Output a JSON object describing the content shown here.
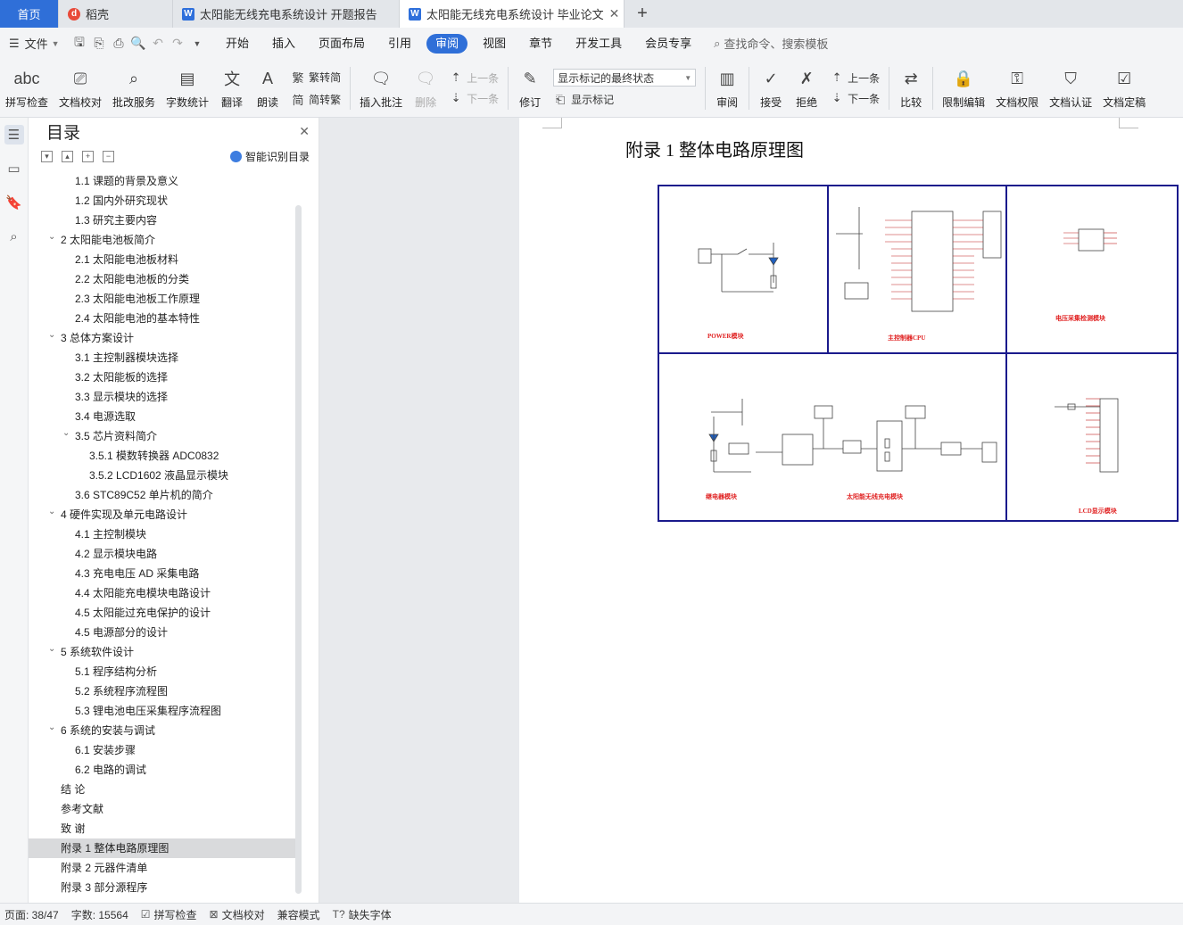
{
  "tabs": {
    "home": "首页",
    "app": "稻壳",
    "doc1": "太阳能无线充电系统设计 开题报告",
    "doc2": "太阳能无线充电系统设计 毕业论文",
    "add": "+"
  },
  "menu": {
    "file": "文件",
    "items": [
      "开始",
      "插入",
      "页面布局",
      "引用",
      "审阅",
      "视图",
      "章节",
      "开发工具",
      "会员专享"
    ],
    "active": "审阅",
    "search": "查找命令、搜索模板"
  },
  "ribbon": {
    "spell": "拼写检查",
    "doc_check": "文档校对",
    "correction": "批改服务",
    "word_count": "字数统计",
    "translate": "翻译",
    "read": "朗读",
    "trad_to_simp": "繁转简",
    "simp_to_trad": "简转繁",
    "insert_comment": "插入批注",
    "delete": "删除",
    "prev": "上一条",
    "next": "下一条",
    "track": "修订",
    "markup_state": "显示标记的最终状态",
    "show_markup": "显示标记",
    "review": "审阅",
    "accept": "接受",
    "reject": "拒绝",
    "prev2": "上一条",
    "next2": "下一条",
    "compare": "比较",
    "restrict": "限制编辑",
    "permission": "文档权限",
    "certify": "文档认证",
    "finalize": "文档定稿"
  },
  "toc": {
    "title": "目录",
    "smart": "智能识别目录",
    "items": [
      {
        "text": "1.1 课题的背景及意义",
        "level": 2
      },
      {
        "text": "1.2 国内外研究现状",
        "level": 2
      },
      {
        "text": "1.3 研究主要内容",
        "level": 2
      },
      {
        "text": "2  太阳能电池板简介",
        "level": 1
      },
      {
        "text": "2.1 太阳能电池板材料",
        "level": 2
      },
      {
        "text": "2.2 太阳能电池板的分类",
        "level": 2
      },
      {
        "text": "2.3 太阳能电池板工作原理",
        "level": 2
      },
      {
        "text": "2.4 太阳能电池的基本特性",
        "level": 2
      },
      {
        "text": "3  总体方案设计",
        "level": 1
      },
      {
        "text": "3.1 主控制器模块选择",
        "level": 2
      },
      {
        "text": "3.2 太阳能板的选择",
        "level": 2
      },
      {
        "text": "3.3 显示模块的选择",
        "level": 2
      },
      {
        "text": "3.4 电源选取",
        "level": 2
      },
      {
        "text": "3.5 芯片资料简介",
        "level": 2,
        "expand": true
      },
      {
        "text": "3.5.1 模数转换器 ADC0832",
        "level": 3
      },
      {
        "text": "3.5.2 LCD1602 液晶显示模块",
        "level": 3
      },
      {
        "text": "3.6 STC89C52 单片机的简介",
        "level": 2
      },
      {
        "text": "4  硬件实现及单元电路设计",
        "level": 1
      },
      {
        "text": "4.1 主控制模块",
        "level": 2
      },
      {
        "text": "4.2 显示模块电路",
        "level": 2
      },
      {
        "text": "4.3 充电电压 AD 采集电路",
        "level": 2
      },
      {
        "text": "4.4 太阳能充电模块电路设计",
        "level": 2
      },
      {
        "text": "4.5 太阳能过充电保护的设计",
        "level": 2
      },
      {
        "text": "4.5 电源部分的设计",
        "level": 2
      },
      {
        "text": "5  系统软件设计",
        "level": 1
      },
      {
        "text": "5.1 程序结构分析",
        "level": 2
      },
      {
        "text": "5.2 系统程序流程图",
        "level": 2
      },
      {
        "text": "5.3 锂电池电压采集程序流程图",
        "level": 2
      },
      {
        "text": "6  系统的安装与调试",
        "level": 1
      },
      {
        "text": "6.1 安装步骤",
        "level": 2
      },
      {
        "text": "6.2 电路的调试",
        "level": 2
      },
      {
        "text": "结   论",
        "level": 0
      },
      {
        "text": "参考文献",
        "level": 0
      },
      {
        "text": "致   谢",
        "level": 0
      },
      {
        "text": "附录 1 整体电路原理图",
        "level": 0,
        "selected": true
      },
      {
        "text": "附录 2 元器件清单",
        "level": 0
      },
      {
        "text": "附录 3 部分源程序",
        "level": 0
      }
    ]
  },
  "document": {
    "heading": "附录 1 整体电路原理图",
    "schematic_labels": {
      "power": "POWER模块",
      "cpu": "主控制器CPU",
      "volt": "电压采集检测模块",
      "relay": "继电器模块",
      "solar": "太阳能无线充电模块",
      "lcd": "LCD显示模块"
    }
  },
  "status": {
    "page": "页面: 38/47",
    "words": "字数: 15564",
    "spell": "拼写检查",
    "check": "文档校对",
    "compat": "兼容模式",
    "missing_font": "缺失字体"
  },
  "colors": {
    "accent": "#2f6fd8",
    "schematic_border": "#1a1a8c",
    "schematic_label": "#e02020"
  }
}
